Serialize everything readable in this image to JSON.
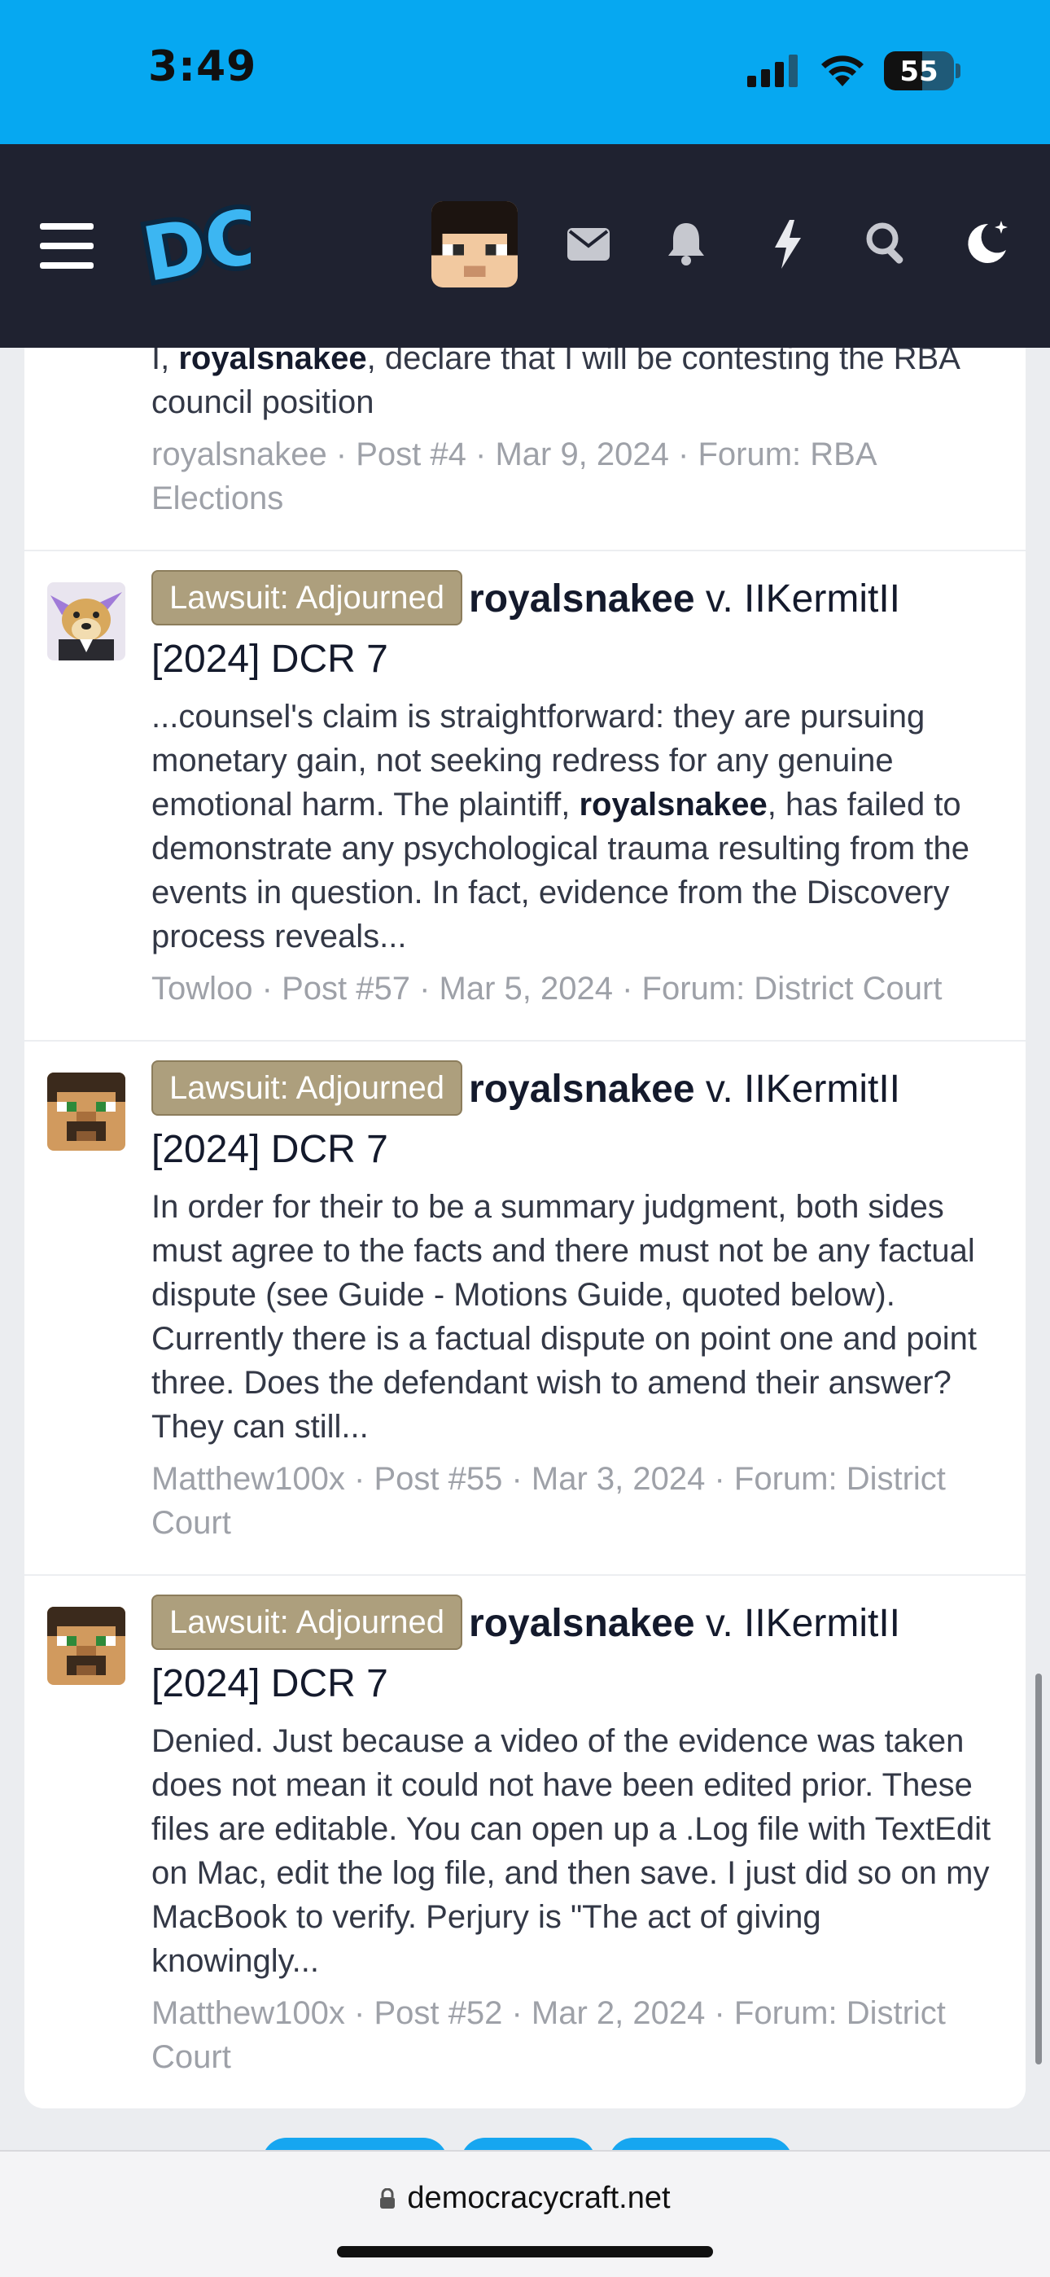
{
  "status_bar": {
    "time": "3:49",
    "battery": "55",
    "battery_level": 0.55
  },
  "nav": {
    "menu_icon": "hamburger-menu-icon",
    "logo_text": "DC",
    "icons": [
      "user-avatar",
      "envelope-icon",
      "bell-icon",
      "lightning-icon",
      "search-icon",
      "moon-icon"
    ]
  },
  "results": [
    {
      "snippet_parts": [
        "I, ",
        "royalsnakee",
        ", declare that I will be contesting the RBA council position"
      ],
      "author": "royalsnakee",
      "post": "Post #4",
      "date": "Mar 9, 2024",
      "forum": "Forum: RBA Elections"
    },
    {
      "avatar": "doge-avatar",
      "prefix": "Lawsuit: Adjourned",
      "title_bold": "royalsnakee",
      "title_rest": " v. IIKermitII [2024] DCR 7",
      "snippet_parts": [
        "...counsel's claim is straightforward: they are pursuing monetary gain, not seeking redress for any genuine emotional harm. The plaintiff, ",
        "royalsnakee",
        ", has failed to demonstrate any psychological trauma resulting from the events in question. In fact, evidence from the Discovery process reveals..."
      ],
      "author": "Towloo",
      "post": "Post #57",
      "date": "Mar 5, 2024",
      "forum": "Forum: District Court"
    },
    {
      "avatar": "minecraft-skin-avatar",
      "prefix": "Lawsuit: Adjourned",
      "title_bold": "royalsnakee",
      "title_rest": " v. IIKermitII [2024] DCR 7",
      "snippet_parts": [
        "In order for their to be a summary judgment, both sides must agree to the facts and there must not be any factual dispute (see Guide - Motions Guide, quoted below). Currently there is a factual dispute on point one and point three. Does the defendant wish to amend their answer? They can still...",
        "",
        ""
      ],
      "author": "Matthew100x",
      "post": "Post #55",
      "date": "Mar 3, 2024",
      "forum": "Forum: District Court"
    },
    {
      "avatar": "minecraft-skin-avatar",
      "prefix": "Lawsuit: Adjourned",
      "title_bold": "royalsnakee",
      "title_rest": " v. IIKermitII [2024] DCR 7",
      "snippet_parts": [
        "Denied. Just because a video of the evidence was taken does not mean it could not have been edited prior. These files are editable. You can open up a .Log file with TextEdit on Mac, edit the log file, and then save. I just did so on my MacBook to verify. Perjury is \"The act of giving knowingly...",
        "",
        ""
      ],
      "author": "Matthew100x",
      "post": "Post #52",
      "date": "Mar 2, 2024",
      "forum": "Forum: District Court"
    }
  ],
  "separator": " · ",
  "browser": {
    "url": "democracycraft.net"
  }
}
